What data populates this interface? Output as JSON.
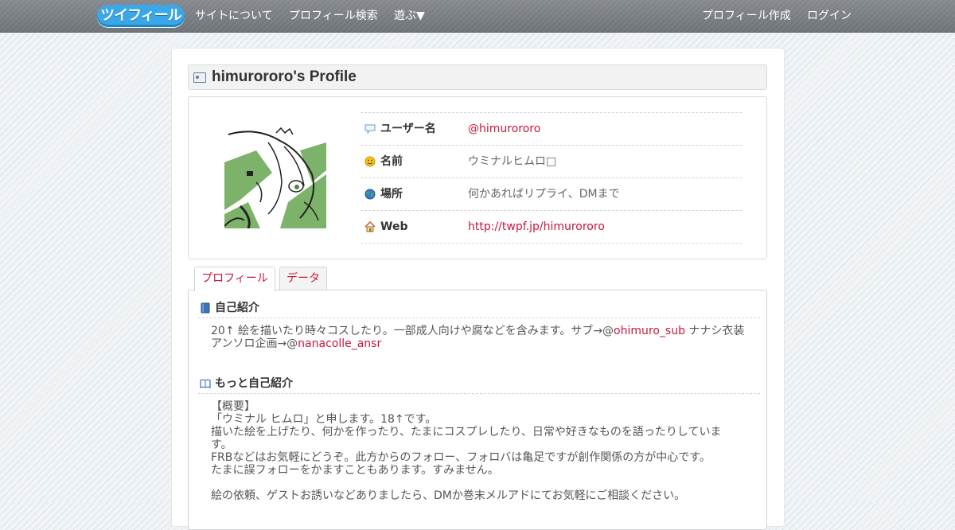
{
  "nav": {
    "logo_text": "ツイフィール",
    "links_left": [
      "サイトについて",
      "プロフィール検索",
      "遊ぶ▼"
    ],
    "links_right": [
      "プロフィール作成",
      "ログイン"
    ]
  },
  "profile": {
    "title": "himurororo's Profile",
    "rows": [
      {
        "label": "ユーザー名",
        "value": "@himurororo",
        "icon": "speech-bubble-icon"
      },
      {
        "label": "名前",
        "value": "ウミナルヒムロ□",
        "icon": "smiley-icon"
      },
      {
        "label": "場所",
        "value": "何かあればリプライ、DMまで",
        "icon": "globe-icon"
      },
      {
        "label": "Web",
        "value": "http://twpf.jp/himurororo",
        "icon": "house-icon"
      }
    ]
  },
  "tabs": [
    "プロフィール",
    "データ"
  ],
  "sections": {
    "intro": {
      "title": "自己紹介",
      "line1_pre": "20↑ 絵を描いたり時々コスしたり。一部成人向けや腐などを含みます。サブ→@",
      "line1_link": "ohimuro_sub",
      "line1_post": " ナナシ衣装",
      "line2_pre": "アンソロ企画→@",
      "line2_link": "nanacolle_ansr"
    },
    "more": {
      "title": "もっと自己紹介",
      "lines": [
        "【概要】",
        "「ウミナル ヒムロ」と申します。18↑です。",
        "描いた絵を上げたり、何かを作ったり、たまにコスプレしたり、日常や好きなものを語ったりしていま",
        "す。",
        "FRBなどはお気軽にどうぞ。此方からのフォロー、フォロバは亀足ですが創作関係の方が中心です。",
        "たまに誤フォローをかますこともあります。すみません。",
        "",
        "絵の依頼、ゲストお誘いなどありましたら、DMか巻末メルアドにてお気軽にご相談ください。"
      ]
    }
  },
  "colors": {
    "link": "#c8173d",
    "logo": "#3aa8e8",
    "navbar": "#7a7f85"
  }
}
